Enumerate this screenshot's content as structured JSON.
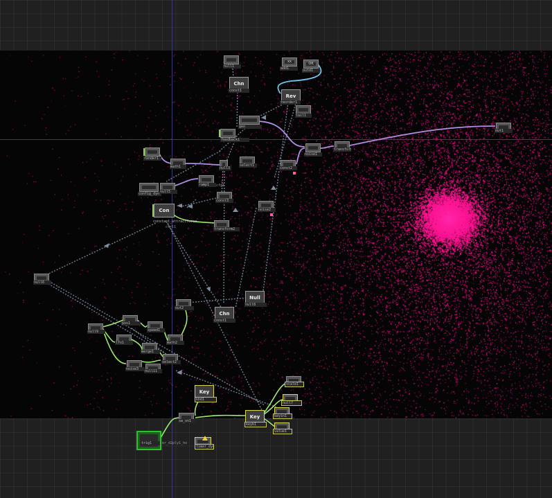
{
  "canvas": {
    "background_color": "#202020",
    "viewer_background": "#050505",
    "particle_color": "#ff1493",
    "wire_colors": {
      "data": "#7d8ea0",
      "geometry": "#b08ee6",
      "control": "#9bea6e",
      "link": "#6ec3ea"
    }
  },
  "nodes": [
    {
      "id": "n_top1",
      "tag": "",
      "label": "null1"
    },
    {
      "id": "n_chan1",
      "tag": "Chn",
      "label": "const1"
    },
    {
      "id": "n_add",
      "tag": "xx",
      "label": "add1"
    },
    {
      "id": "n_ok",
      "tag": "OK",
      "label": "outd1"
    },
    {
      "id": "n_rev",
      "tag": "Rev",
      "label": "reorder1"
    },
    {
      "id": "n_tail",
      "tag": "",
      "label": "tail1"
    },
    {
      "id": "n_geo",
      "tag": "",
      "label": "geo"
    },
    {
      "id": "n_feed",
      "tag": "",
      "label": "feedback1"
    },
    {
      "id": "n_noise1",
      "tag": "",
      "label": "noise1"
    },
    {
      "id": "n_out",
      "tag": "",
      "label": "out1"
    },
    {
      "id": "n_trans",
      "tag": "",
      "label": "transform1"
    },
    {
      "id": "n_rend",
      "tag": "",
      "label": "render1"
    },
    {
      "id": "n_math",
      "tag": "",
      "label": "math1"
    },
    {
      "id": "n_null3",
      "tag": "",
      "label": "null3"
    },
    {
      "id": "n_sel",
      "tag": "",
      "label": "select1"
    },
    {
      "id": "n_const2",
      "tag": "",
      "label": "const2"
    },
    {
      "id": "n_ramp",
      "tag": "",
      "label": "ramp1"
    },
    {
      "id": "n_cfg",
      "tag": "",
      "label": "config_dyn"
    },
    {
      "id": "n_null5",
      "tag": "",
      "label": "null5"
    },
    {
      "id": "n_const3",
      "tag": "",
      "label": "const3"
    },
    {
      "id": "n_con",
      "tag": "Con",
      "label": "constant_attractforce"
    },
    {
      "id": "n_null4",
      "tag": "",
      "label": "noise2"
    },
    {
      "id": "n_tf2",
      "tag": "",
      "label": "transform2"
    },
    {
      "id": "n_null6",
      "tag": "",
      "label": "null6"
    },
    {
      "id": "n_out2",
      "tag": "",
      "label": "out2"
    },
    {
      "id": "n_chan2",
      "tag": "Chn",
      "label": "const1"
    },
    {
      "id": "n_null8",
      "tag": "Null",
      "label": "null8"
    },
    {
      "id": "n_null_l",
      "tag": "",
      "label": "null9"
    },
    {
      "id": "n_pos",
      "tag": "",
      "label": "pos1"
    },
    {
      "id": "n_speed",
      "tag": "",
      "label": "speed1"
    },
    {
      "id": "n_lfo",
      "tag": "",
      "label": "lfo1"
    },
    {
      "id": "n_math2",
      "tag": "",
      "label": "math2"
    },
    {
      "id": "n_merge",
      "tag": "",
      "label": "merge1"
    },
    {
      "id": "n_sel2",
      "tag": "",
      "label": "select2"
    },
    {
      "id": "n_noise3",
      "tag": "",
      "label": "noise3"
    },
    {
      "id": "n_null11",
      "tag": "",
      "label": "null11"
    },
    {
      "id": "n_scale",
      "tag": "",
      "label": "scale1"
    },
    {
      "id": "n_key",
      "tag": "Key",
      "label": "kbd1"
    },
    {
      "id": "n_null7",
      "tag": "",
      "label": "null7"
    },
    {
      "id": "n_key2",
      "tag": "Key",
      "label": "keyb1"
    },
    {
      "id": "n_sw",
      "tag": "",
      "label": "sw_on1"
    },
    {
      "id": "n_in1",
      "tag": "",
      "label": "keyin1"
    },
    {
      "id": "n_val",
      "tag": "",
      "label": "value1"
    },
    {
      "id": "n_tr",
      "tag": "",
      "label": "trig1"
    },
    {
      "id": "n_perf",
      "tag": "",
      "label": "perform1"
    },
    {
      "id": "n_warn",
      "tag": "",
      "label": "timer_dyn"
    }
  ],
  "captions": [
    {
      "id": "cap_cfg",
      "text": "cfg1"
    },
    {
      "id": "cap_out",
      "text": "ctrl1"
    },
    {
      "id": "cap_perf",
      "text": "er_d2ply1_ho"
    }
  ]
}
